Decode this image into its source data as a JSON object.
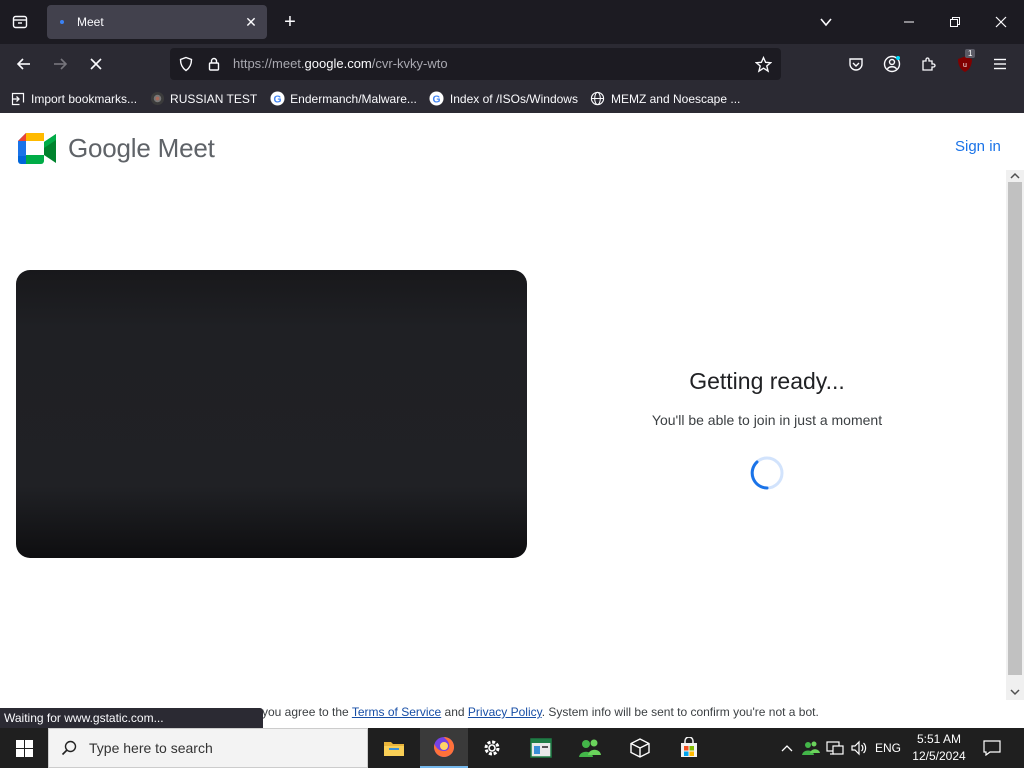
{
  "browser": {
    "tab_title": "Meet",
    "url_prefix": "https://meet.",
    "url_host": "google.com",
    "url_path": "/cvr-kvky-wto",
    "extension_badge": "1",
    "bookmarks": [
      {
        "label": "Import bookmarks...",
        "icon": "import-icon"
      },
      {
        "label": "RUSSIAN TEST",
        "icon": "github-icon"
      },
      {
        "label": "Endermanch/Malware...",
        "icon": "google-icon"
      },
      {
        "label": "Index of /ISOs/Windows",
        "icon": "google-icon"
      },
      {
        "label": "MEMZ and Noescape ...",
        "icon": "globe-icon"
      }
    ],
    "status_text": "Waiting for www.gstatic.com..."
  },
  "page": {
    "logo_text": "Google Meet",
    "sign_in": "Sign in",
    "ready_title": "Getting ready...",
    "ready_subtitle": "You'll be able to join in just a moment",
    "footer_prefix": "you agree to the ",
    "terms_link": "Terms of Service",
    "footer_and": " and ",
    "privacy_link": "Privacy Policy",
    "footer_suffix": ". System info will be sent to confirm you're not a bot.",
    "brand_colors": {
      "blue": "#1a73e8",
      "green": "#00ac47",
      "yellow": "#ffba00",
      "red": "#ea4335"
    }
  },
  "taskbar": {
    "search_placeholder": "Type here to search",
    "time": "5:51 AM",
    "date": "12/5/2024",
    "language": "ENG"
  }
}
